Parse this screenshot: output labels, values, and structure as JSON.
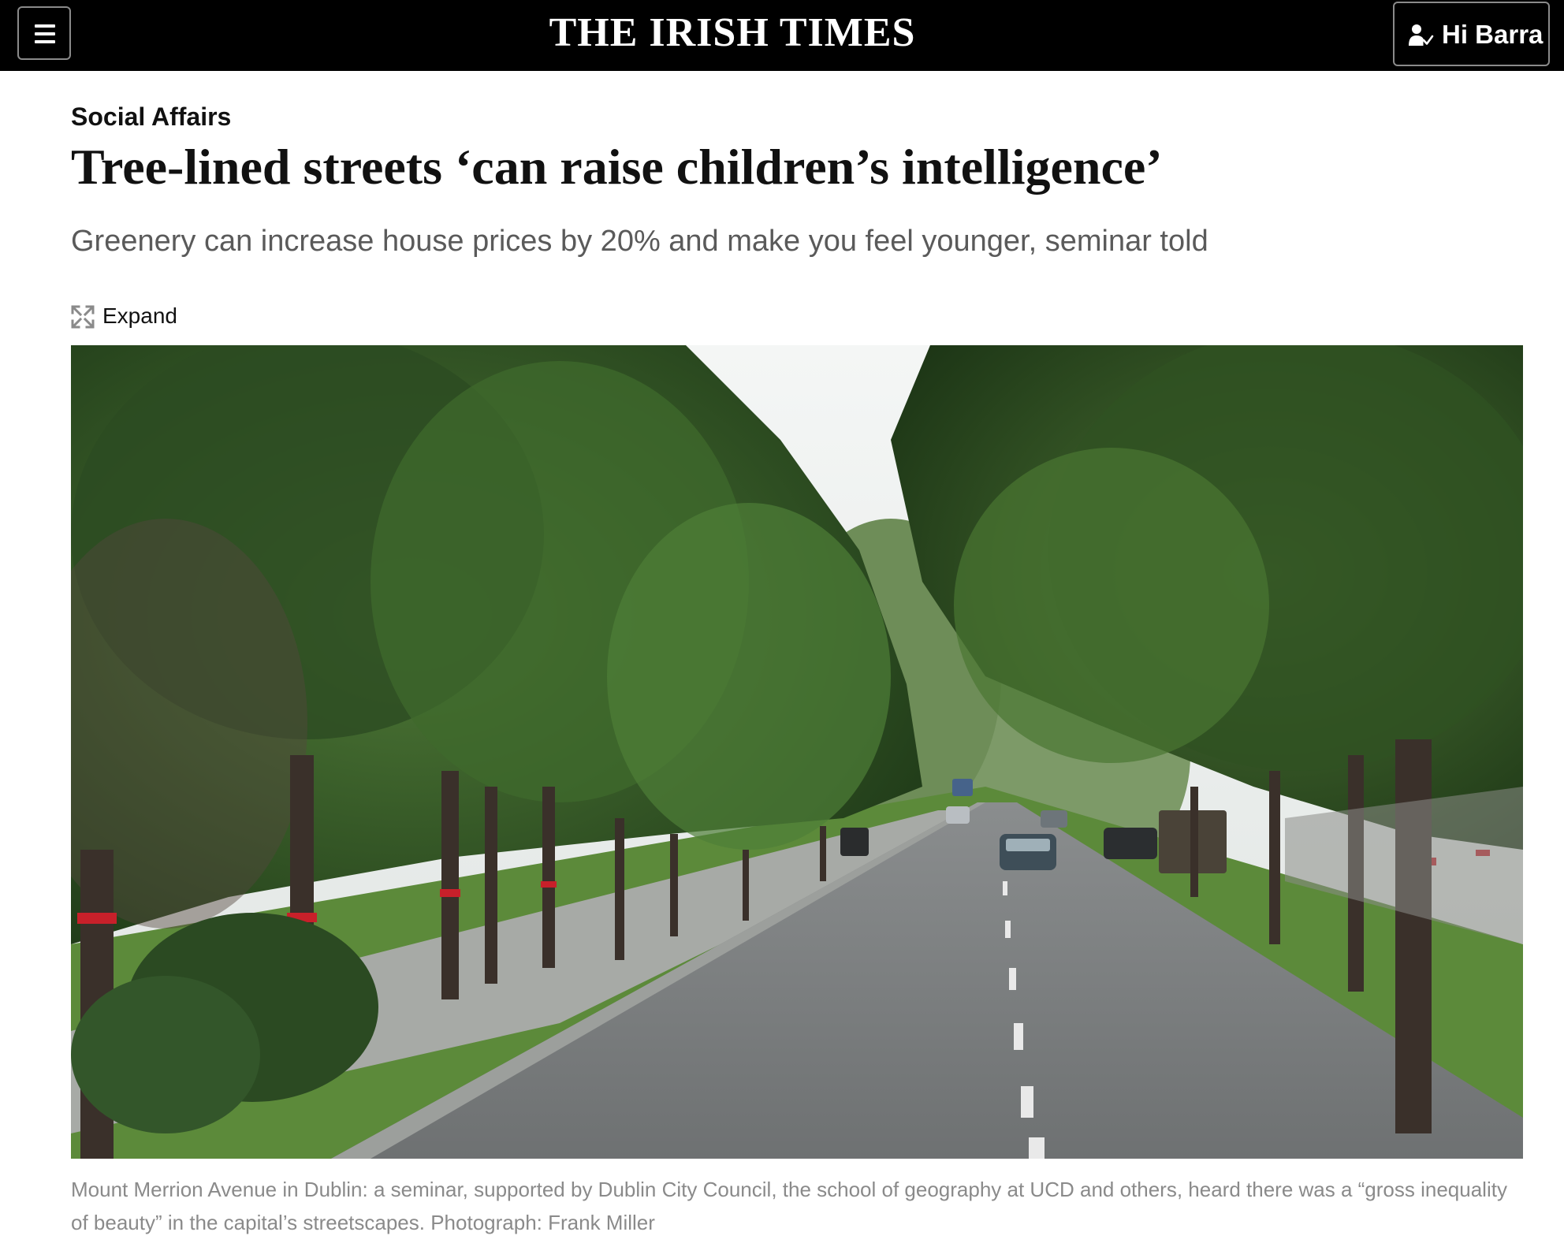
{
  "header": {
    "masthead": "THE IRISH TIMES",
    "menu_icon": "hamburger-menu-icon",
    "account_icon": "user-check-icon",
    "account_label": "Hi Barra"
  },
  "article": {
    "section": "Social Affairs",
    "headline": "Tree-lined streets ‘can raise children’s intelligence’",
    "standfirst": "Greenery can increase house prices by 20% and make you feel younger, seminar told",
    "expand_label": "Expand",
    "expand_icon": "expand-arrows-icon",
    "image_caption": "Mount Merrion Avenue in Dublin: a seminar, supported by Dublin City Council, the school of geography at UCD and others, heard there was a “gross inequality of beauty” in the capital’s streetscapes. Photograph: Frank Miller"
  },
  "colors": {
    "topbar_bg": "#000000",
    "masthead_text": "#ffffff",
    "headline_text": "#111111",
    "standfirst_text": "#5a5a5a",
    "caption_text": "#8a8a8a"
  }
}
